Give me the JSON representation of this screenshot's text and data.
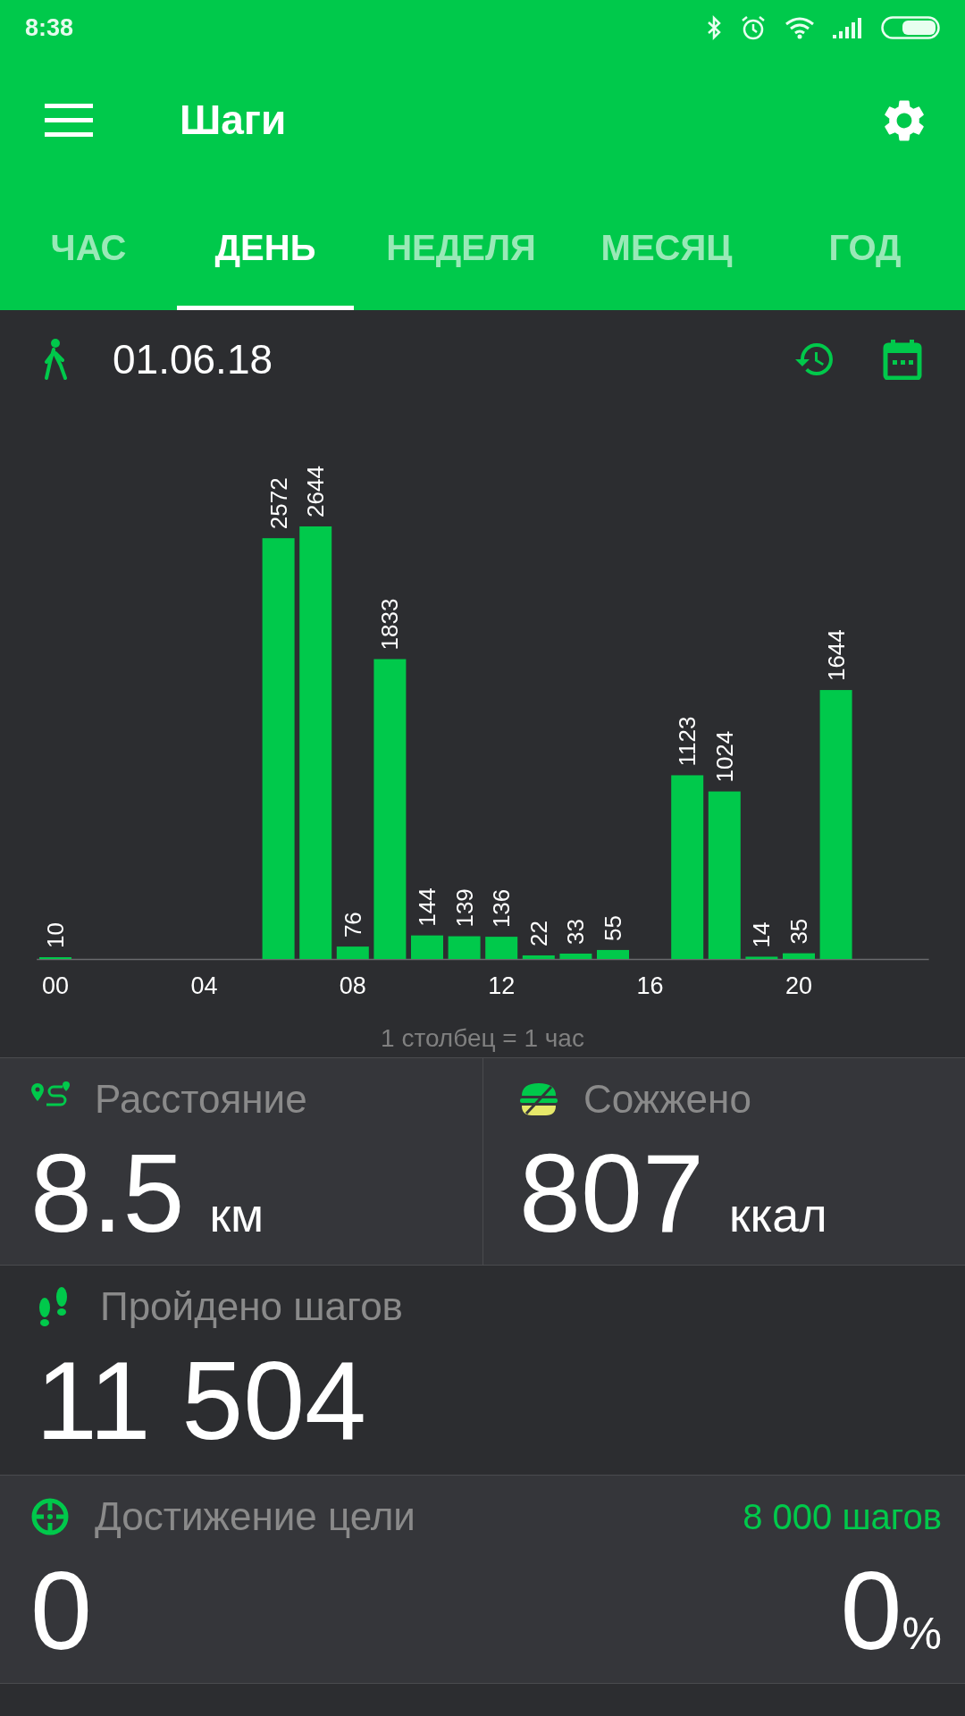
{
  "status_bar": {
    "time": "8:38"
  },
  "app_bar": {
    "title": "Шаги"
  },
  "tabs": [
    {
      "label": "ЧАС",
      "selected": false
    },
    {
      "label": "ДЕНЬ",
      "selected": true
    },
    {
      "label": "НЕДЕЛЯ",
      "selected": false
    },
    {
      "label": "МЕСЯЦ",
      "selected": false
    },
    {
      "label": "ГОД",
      "selected": false
    }
  ],
  "date_row": {
    "date": "01.06.18"
  },
  "chart": {
    "caption": "1 столбец = 1 час",
    "chart_data": {
      "type": "bar",
      "x": [
        0,
        6,
        7,
        8,
        9,
        10,
        11,
        12,
        13,
        14,
        15,
        17,
        18,
        19,
        20,
        21
      ],
      "values": [
        10,
        2572,
        2644,
        76,
        1833,
        144,
        139,
        136,
        22,
        33,
        55,
        1123,
        1024,
        14,
        35,
        1644
      ],
      "xlim": [
        -0.5,
        23.5
      ],
      "xticks": [
        {
          "value": 0,
          "label": "00"
        },
        {
          "value": 4,
          "label": "04"
        },
        {
          "value": 8,
          "label": "08"
        },
        {
          "value": 12,
          "label": "12"
        },
        {
          "value": 16,
          "label": "16"
        },
        {
          "value": 20,
          "label": "20"
        }
      ],
      "data_labels": true
    }
  },
  "stats": [
    {
      "kind": "half",
      "label": "Расстояние",
      "value": "8.5",
      "unit": "км"
    },
    {
      "kind": "half",
      "label": "Сожжено",
      "value": "807",
      "unit": "ккал"
    },
    {
      "kind": "full",
      "label": "Пройдено шагов",
      "value": "11 504"
    },
    {
      "kind": "goal",
      "label": "Достижение цели",
      "target": "8 000 шагов",
      "value": "0",
      "percent": "0",
      "percent_unit": "%"
    }
  ]
}
